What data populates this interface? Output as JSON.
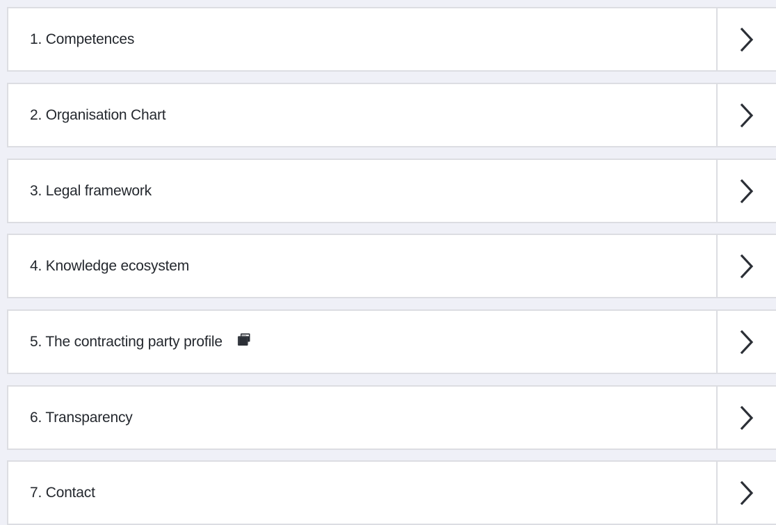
{
  "menu": {
    "items": [
      {
        "label": "1. Competences",
        "external": false
      },
      {
        "label": "2. Organisation Chart",
        "external": false
      },
      {
        "label": "3. Legal framework",
        "external": false
      },
      {
        "label": "4. Knowledge ecosystem",
        "external": false
      },
      {
        "label": "5. The contracting party profile",
        "external": true,
        "external_icon": "external-window-icon"
      },
      {
        "label": "6. Transparency",
        "external": false
      },
      {
        "label": "7. Contact",
        "external": false
      }
    ],
    "arrow_icon": "chevron-right-icon"
  },
  "colors": {
    "background": "#eff0f7",
    "card": "#ffffff",
    "border": "#dcdde2",
    "text": "#24282e",
    "icon": "#2b2f36"
  }
}
